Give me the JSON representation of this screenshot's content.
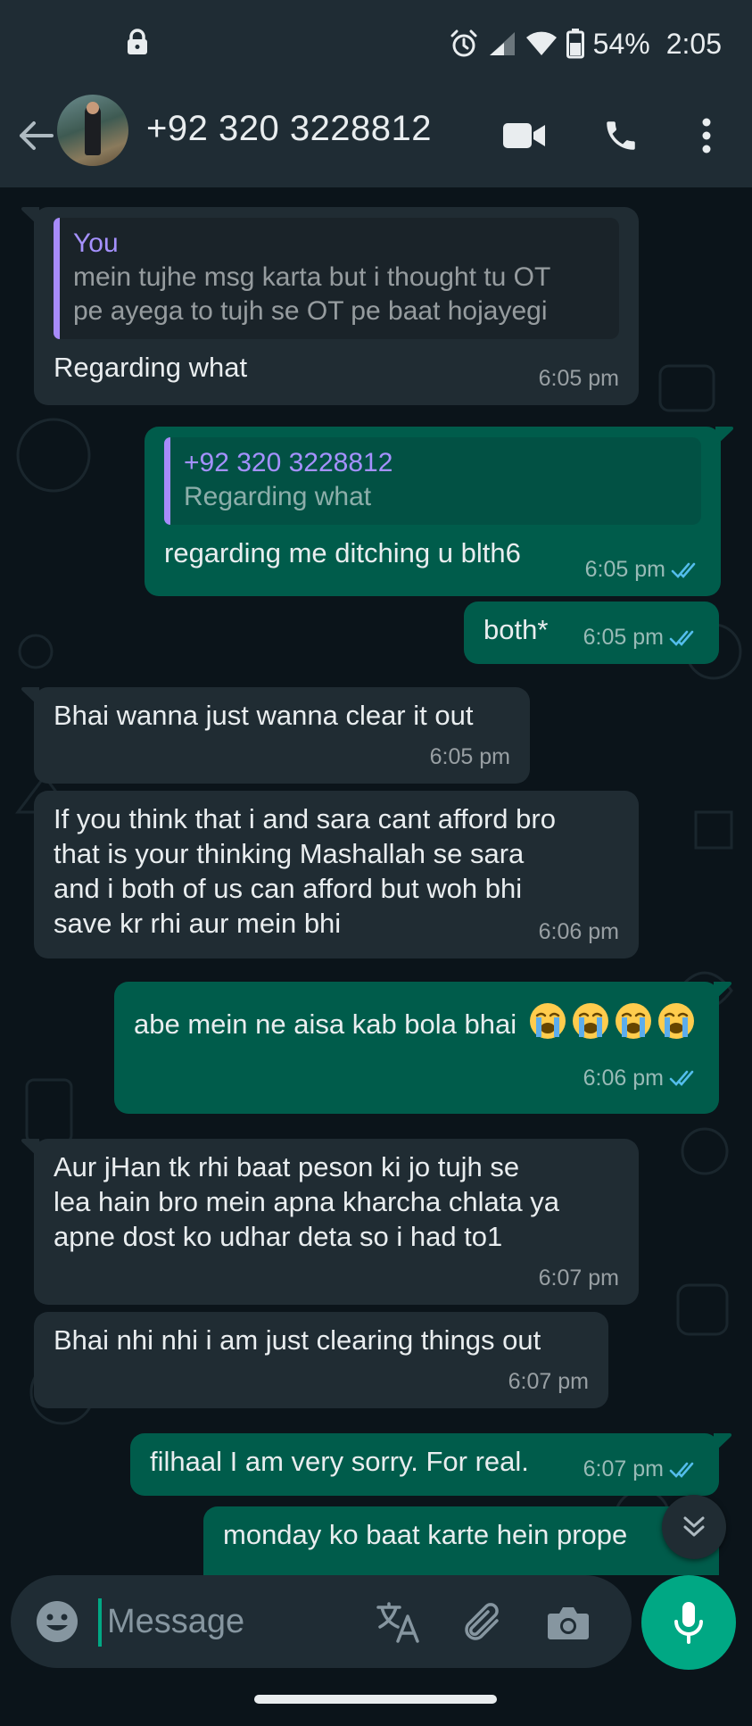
{
  "status_bar": {
    "battery": "54%",
    "time": "2:05",
    "icons": [
      "lock-icon",
      "alarm-icon",
      "signal-icon",
      "wifi-icon",
      "battery-icon"
    ]
  },
  "header": {
    "contact": "+92 320 3228812",
    "icons": [
      "back-arrow-icon",
      "video-call-icon",
      "voice-call-icon",
      "more-options-icon"
    ]
  },
  "messages": [
    {
      "direction": "in",
      "quote": {
        "author": "You",
        "text": "mein tujhe msg karta but i thought tu OT\npe ayega to tujh se OT pe baat hojayegi"
      },
      "text": "Regarding what",
      "time": "6:05 pm"
    },
    {
      "direction": "out",
      "quote": {
        "author": "+92 320 3228812",
        "text": "Regarding what"
      },
      "text": "regarding me ditching u blth6",
      "time": "6:05 pm",
      "read": true
    },
    {
      "direction": "out",
      "text": "both*",
      "time": "6:05 pm",
      "read": true
    },
    {
      "direction": "in",
      "text": "Bhai wanna just wanna clear it out",
      "time": "6:05 pm"
    },
    {
      "direction": "in",
      "text": "If you think that i and sara cant afford bro\nthat is your thinking Mashallah se sara\nand i both of us can afford but woh bhi\nsave kr rhi aur mein bhi",
      "time": "6:06 pm"
    },
    {
      "direction": "out",
      "text": "abe mein ne aisa kab bola bhai",
      "emoji": "loudly-crying-face",
      "emoji_count": 4,
      "time": "6:06 pm",
      "read": true
    },
    {
      "direction": "in",
      "text": "Aur jHan tk rhi baat peson ki jo tujh se\nlea hain bro mein apna kharcha chlata ya\napne dost ko udhar deta so i had to1",
      "time": "6:07 pm"
    },
    {
      "direction": "in",
      "text": "Bhai nhi nhi i am just clearing things out",
      "time": "6:07 pm"
    },
    {
      "direction": "out",
      "text": "filhaal I am very sorry. For real.",
      "time": "6:07 pm",
      "read": true
    },
    {
      "direction": "out",
      "text": "monday ko baat karte hein prope",
      "partial": true
    }
  ],
  "composer": {
    "placeholder": "Message",
    "icons": [
      "emoji-icon",
      "translate-icon",
      "attach-icon",
      "camera-icon",
      "mic-icon"
    ]
  },
  "colors": {
    "header_bg": "#1f2c34",
    "chat_bg": "#0b141a",
    "incoming_bubble": "#202c33",
    "outgoing_bubble": "#005c4b",
    "accent": "#00a884",
    "read_ticks": "#53bdeb",
    "quote_author": "#a591ff"
  }
}
